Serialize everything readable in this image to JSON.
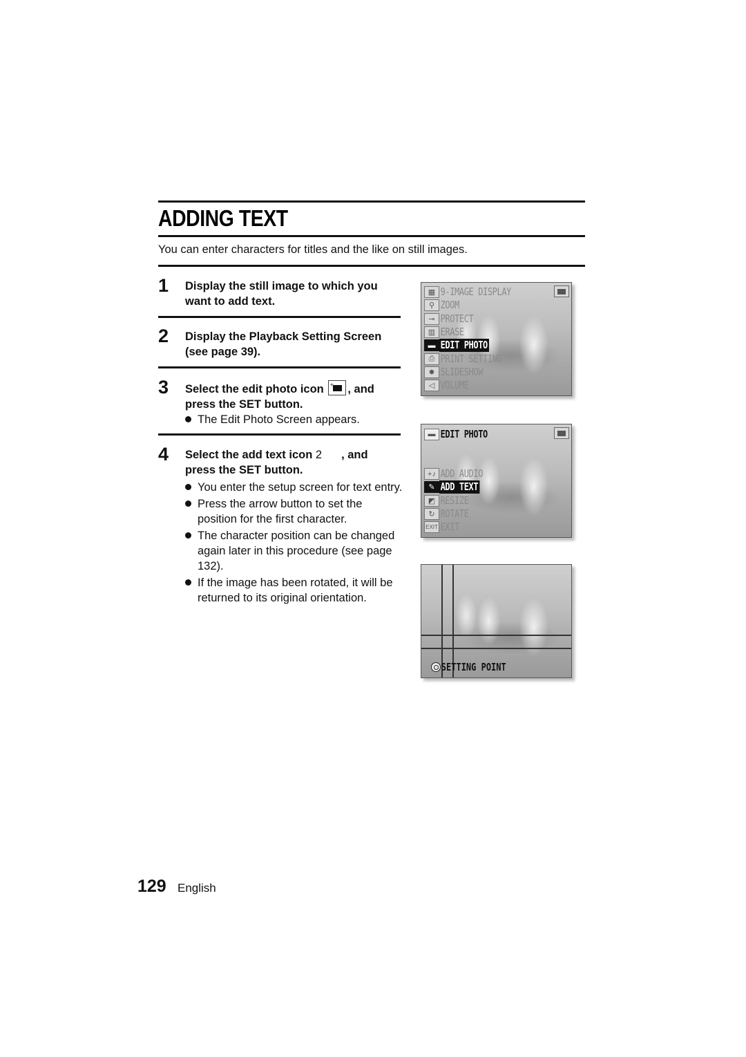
{
  "page": {
    "title": "ADDING TEXT",
    "intro": "You can enter characters for titles and the like on still images.",
    "steps": [
      {
        "number": "1",
        "text": "Display the still image to which you want to add text."
      },
      {
        "number": "2",
        "text": "Display the Playback Setting Screen (see page 39)."
      },
      {
        "number": "3",
        "text_before_icon": "Select the edit photo icon",
        "text_after_icon": ", and press the SET button.",
        "icon": "edit-photo-icon",
        "bullets": [
          "The Edit Photo Screen appears."
        ]
      },
      {
        "number": "4",
        "text_before_icon": "Select the add text icon",
        "icon_placeholder": "2",
        "text_after_icon": ", and press the SET button.",
        "bullets": [
          "You enter the setup screen for text entry.",
          "Press the arrow button to set the position for the first character.",
          "The character position can be changed again later in this procedure (see page 132).",
          "If the image has been rotated, it will be returned to its original orientation."
        ]
      }
    ],
    "footer": {
      "page_number": "129",
      "language": "English"
    }
  },
  "screens": {
    "playback_menu": {
      "items": [
        {
          "icon": "nine-grid-icon",
          "glyph": "▦",
          "label": "9-IMAGE DISPLAY",
          "selected": false
        },
        {
          "icon": "magnifier-icon",
          "glyph": "⚲",
          "label": "ZOOM",
          "selected": false
        },
        {
          "icon": "key-icon",
          "glyph": "⊸",
          "label": "PROTECT",
          "selected": false
        },
        {
          "icon": "trash-icon",
          "glyph": "▥",
          "label": "ERASE",
          "selected": false
        },
        {
          "icon": "edit-photo-icon",
          "glyph": "▬",
          "label": "EDIT PHOTO",
          "selected": true
        },
        {
          "icon": "printer-icon",
          "glyph": "⎙",
          "label": "PRINT SETTING",
          "selected": false
        },
        {
          "icon": "slideshow-icon",
          "glyph": "✸",
          "label": "SLIDESHOW",
          "selected": false
        },
        {
          "icon": "speaker-icon",
          "glyph": "◁",
          "label": "VOLUME",
          "selected": false
        }
      ]
    },
    "edit_photo_menu": {
      "header": {
        "icon": "edit-photo-icon",
        "glyph": "▬",
        "label": "EDIT PHOTO"
      },
      "items": [
        {
          "icon": "add-audio-icon",
          "glyph": "+♪",
          "label": "ADD AUDIO",
          "selected": false
        },
        {
          "icon": "pencil-icon",
          "glyph": "✎",
          "label": "ADD TEXT",
          "selected": true
        },
        {
          "icon": "resize-icon",
          "glyph": "◩",
          "label": "RESIZE",
          "selected": false
        },
        {
          "icon": "rotate-icon",
          "glyph": "↻",
          "label": "ROTATE",
          "selected": false
        },
        {
          "icon": "exit-icon",
          "glyph": "EXIT",
          "label": "EXIT",
          "selected": false
        }
      ]
    },
    "setting_point": {
      "label": "SETTING POINT"
    }
  }
}
